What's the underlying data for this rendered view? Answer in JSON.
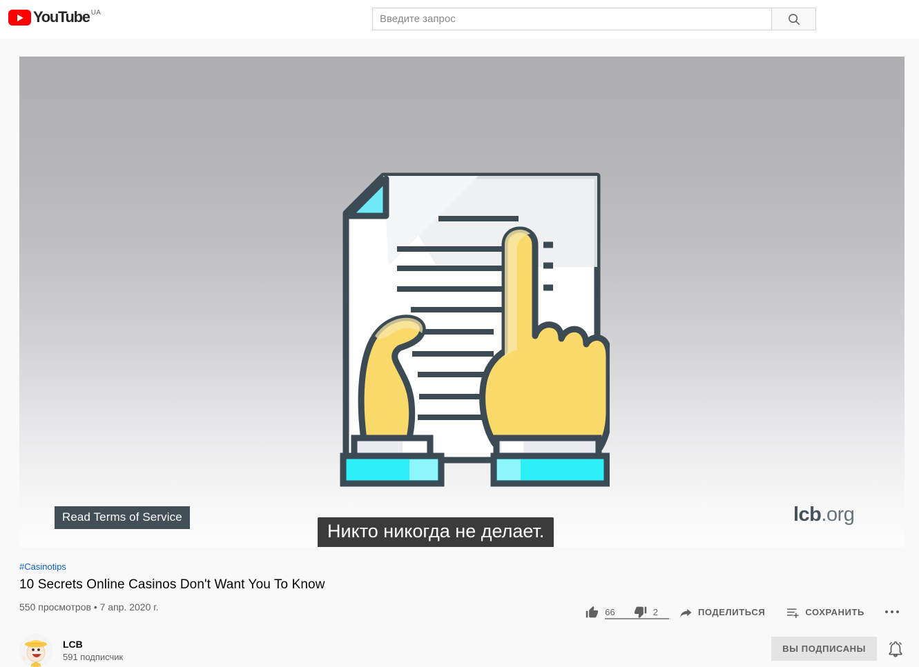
{
  "header": {
    "logo_text": "YouTube",
    "logo_country": "UA",
    "logo_color": "#ff0000",
    "search": {
      "placeholder": "Введите запрос",
      "value": "",
      "button_icon": "search-icon"
    }
  },
  "player": {
    "caption_overlay": "Read Terms of Service",
    "subtitle": "Никто никогда не делает.",
    "watermark_bold": "lcb",
    "watermark_light": ".org",
    "illustration": {
      "name": "document-with-pointing-hands",
      "paper_color": "#ffffff",
      "paper_shade": "#eceef1",
      "fold_color": "#6fe9f7",
      "outline_color": "#3c4a54",
      "hand_color": "#fad96b",
      "hand_shadow": "#f6cf55",
      "cuff_color": "#e9ebee",
      "sleeve_color": "#2ceff7",
      "sleeve_shade": "#8df6fb"
    },
    "background_top_color": "#aeaeb1",
    "background_bottom_color": "#fdfdfd"
  },
  "video": {
    "hashtag": "#Casinotips",
    "title": "10 Secrets Online Casinos Don't Want You To Know",
    "views_and_date": "550 просмотров • 7 апр. 2020 г.",
    "likes": "66",
    "dislikes": "2",
    "share_label": "ПОДЕЛИТЬСЯ",
    "save_label": "СОХРАНИТЬ",
    "like_ratio_percent": 97,
    "link_color": "#065fd4"
  },
  "channel": {
    "name": "LCB",
    "subscribers": "591 подписчик",
    "subscribe_label": "ВЫ ПОДПИСАНЫ",
    "bell_icon": "notification-bell-icon",
    "avatar_icon": "channel-avatar"
  }
}
